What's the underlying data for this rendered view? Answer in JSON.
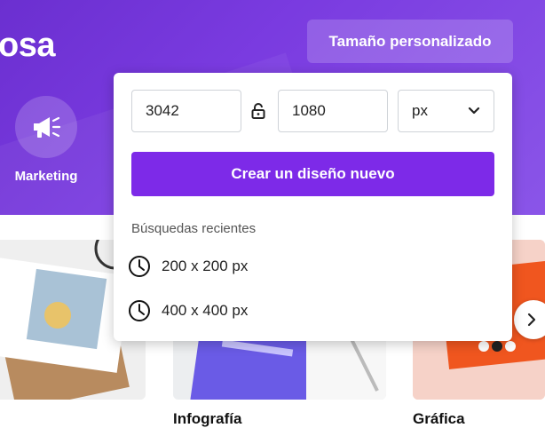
{
  "hero": {
    "title_fragment": "osa",
    "custom_size_button": "Tamaño personalizado",
    "category": {
      "label": "Marketing",
      "icon": "megaphone-icon"
    }
  },
  "custom_size_panel": {
    "width_value": "3042",
    "height_value": "1080",
    "lock_icon": "unlock-icon",
    "unit": "px",
    "create_button": "Crear un diseño nuevo",
    "recent_title": "Búsquedas recientes",
    "recent_items": [
      "200 x 200 px",
      "400 x 400 px"
    ]
  },
  "templates": {
    "cards": [
      {
        "label": ""
      },
      {
        "label": "Infografía"
      },
      {
        "label": "Gráfica"
      }
    ],
    "next_icon": "chevron-right-icon"
  },
  "colors": {
    "hero_purple": "#7a3be0",
    "primary_button": "#7d2ae8"
  }
}
